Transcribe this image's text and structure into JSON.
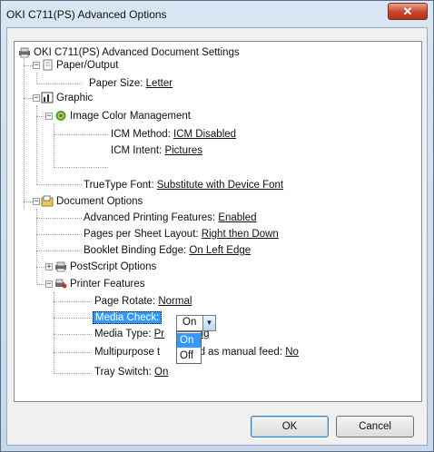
{
  "window": {
    "title": "OKI C711(PS) Advanced Options",
    "close_glyph": "✕"
  },
  "tree": {
    "root": "OKI C711(PS) Advanced Document Settings",
    "paper_output": {
      "label": "Paper/Output",
      "paper_size_label": "Paper Size:",
      "paper_size_value": "Letter"
    },
    "graphic": {
      "label": "Graphic",
      "icm": {
        "label": "Image Color Management",
        "method_label": "ICM Method:",
        "method_value": "ICM Disabled",
        "intent_label": "ICM Intent:",
        "intent_value": "Pictures"
      },
      "truetype_label": "TrueType Font:",
      "truetype_value": "Substitute with Device Font"
    },
    "document_options": {
      "label": "Document Options",
      "advanced_label": "Advanced Printing Features:",
      "advanced_value": "Enabled",
      "pages_label": "Pages per Sheet Layout:",
      "pages_value": "Right then Down",
      "booklet_label": "Booklet Binding Edge:",
      "booklet_value": "On Left Edge",
      "postscript_label": "PostScript Options",
      "printer_features": {
        "label": "Printer Features",
        "rotate_label": "Page Rotate:",
        "rotate_value": "Normal",
        "media_check_label": "Media Check:",
        "media_check_value": "On",
        "media_type_label": "Media Type:",
        "media_type_value_visible": "Pr",
        "media_type_value_tail": "ing",
        "multipurpose_label_visible": "Multipurpose t",
        "multipurpose_label_tail": "dled as manual feed:",
        "multipurpose_value": "No",
        "tray_label": "Tray Switch:",
        "tray_value": "On"
      }
    }
  },
  "dropdown": {
    "options": [
      "On",
      "Off"
    ],
    "highlighted": "On"
  },
  "buttons": {
    "ok": "OK",
    "cancel": "Cancel"
  }
}
